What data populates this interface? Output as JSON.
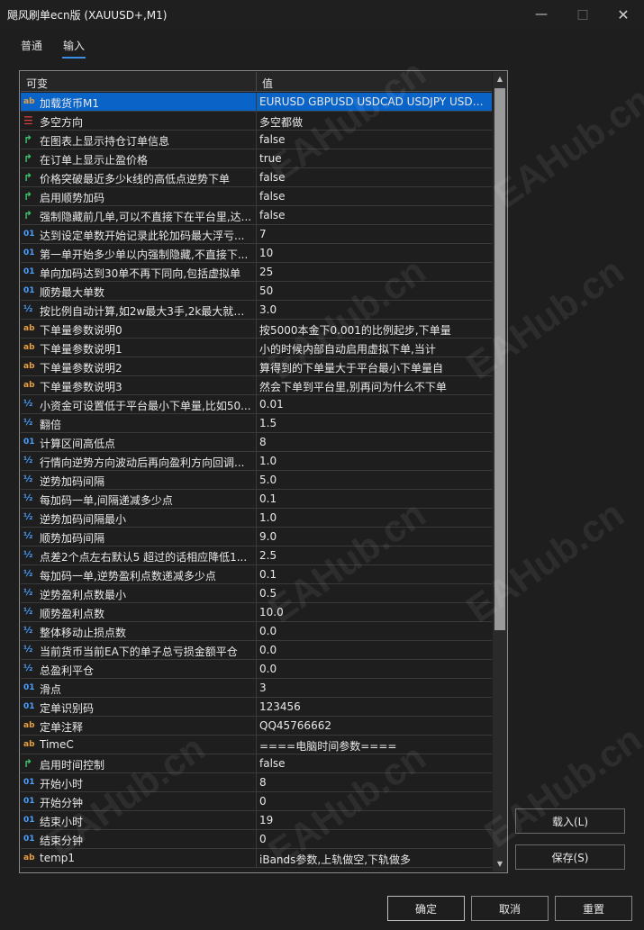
{
  "window": {
    "title": "飓风刷单ecn版 (XAUUSD+,M1)"
  },
  "tabs": [
    {
      "label": "普通"
    },
    {
      "label": "输入"
    }
  ],
  "grid": {
    "col_variable": "可变",
    "col_value": "值",
    "rows": [
      {
        "icon": "ab",
        "name": "加载货币M1",
        "value": "EURUSD GBPUSD USDCAD USDJPY USDC..."
      },
      {
        "icon": "enum",
        "name": "多空方向",
        "value": "多空都做"
      },
      {
        "icon": "bool",
        "name": "在图表上显示持仓订单信息",
        "value": "false"
      },
      {
        "icon": "bool",
        "name": "在订单上显示止盈价格",
        "value": "true"
      },
      {
        "icon": "bool",
        "name": "价格突破最近多少k线的高低点逆势下单",
        "value": "false"
      },
      {
        "icon": "bool",
        "name": "启用顺势加码",
        "value": "false"
      },
      {
        "icon": "bool",
        "name": "强制隐藏前几单,可以不直接下在平台里,达...",
        "value": "false"
      },
      {
        "icon": "01",
        "name": "达到设定单数开始记录此轮加码最大浮亏...",
        "value": "7"
      },
      {
        "icon": "01",
        "name": "第一单开始多少单以内强制隐藏,不直接下...",
        "value": "10"
      },
      {
        "icon": "01",
        "name": "单向加码达到30单不再下同向,包括虚拟单",
        "value": "25"
      },
      {
        "icon": "01",
        "name": "顺势最大单数",
        "value": "50"
      },
      {
        "icon": "half",
        "name": "按比例自动计算,如2w最大3手,2k最大就是...",
        "value": "3.0"
      },
      {
        "icon": "ab",
        "name": "下单量参数说明0",
        "value": "按5000本金下0.001的比例起步,下单量"
      },
      {
        "icon": "ab",
        "name": "下单量参数说明1",
        "value": "小的时候内部自动启用虚拟下单,当计"
      },
      {
        "icon": "ab",
        "name": "下单量参数说明2",
        "value": "算得到的下单量大于平台最小下单量自"
      },
      {
        "icon": "ab",
        "name": "下单量参数说明3",
        "value": "然会下单到平台里,别再问为什么不下单"
      },
      {
        "icon": "half",
        "name": "小资金可设置低于平台最小下单量,比如50...",
        "value": "0.01"
      },
      {
        "icon": "half",
        "name": "翻倍",
        "value": "1.5"
      },
      {
        "icon": "01",
        "name": "计算区间高低点",
        "value": "8"
      },
      {
        "icon": "half",
        "name": "行情向逆势方向波动后再向盈利方向回调...",
        "value": "1.0"
      },
      {
        "icon": "half",
        "name": "逆势加码间隔",
        "value": "5.0"
      },
      {
        "icon": "half",
        "name": "每加码一单,间隔递减多少点",
        "value": "0.1"
      },
      {
        "icon": "half",
        "name": "逆势加码间隔最小",
        "value": "1.0"
      },
      {
        "icon": "half",
        "name": "顺势加码间隔",
        "value": "9.0"
      },
      {
        "icon": "half",
        "name": "点差2个点左右默认5  超过的话相应降低1...",
        "value": "2.5"
      },
      {
        "icon": "half",
        "name": "每加码一单,逆势盈利点数递减多少点",
        "value": "0.1"
      },
      {
        "icon": "half",
        "name": "逆势盈利点数最小",
        "value": "0.5"
      },
      {
        "icon": "half",
        "name": "顺势盈利点数",
        "value": "10.0"
      },
      {
        "icon": "half",
        "name": "整体移动止损点数",
        "value": "0.0"
      },
      {
        "icon": "half",
        "name": "当前货币当前EA下的单子总亏损金额平仓",
        "value": "0.0"
      },
      {
        "icon": "half",
        "name": "总盈利平仓",
        "value": "0.0"
      },
      {
        "icon": "01",
        "name": "滑点",
        "value": "3"
      },
      {
        "icon": "01",
        "name": "定单识别码",
        "value": "123456"
      },
      {
        "icon": "ab",
        "name": "定单注释",
        "value": "QQ45766662"
      },
      {
        "icon": "ab",
        "name": "TimeC",
        "value": "====电脑时间参数===="
      },
      {
        "icon": "bool",
        "name": "启用时间控制",
        "value": "false"
      },
      {
        "icon": "01",
        "name": "开始小时",
        "value": "8"
      },
      {
        "icon": "01",
        "name": "开始分钟",
        "value": "0"
      },
      {
        "icon": "01",
        "name": "结束小时",
        "value": "19"
      },
      {
        "icon": "01",
        "name": "结束分钟",
        "value": "0"
      },
      {
        "icon": "ab",
        "name": "temp1",
        "value": "iBands参数,上轨做空,下轨做多"
      }
    ]
  },
  "buttons": {
    "load": "载入(L)",
    "save": "保存(S)",
    "ok": "确定",
    "cancel": "取消",
    "reset": "重置"
  },
  "icons": {
    "ab": "ab",
    "01": "01",
    "half": "½",
    "bool": "↱",
    "enum": "☰"
  },
  "watermark": "EAHub.cn"
}
